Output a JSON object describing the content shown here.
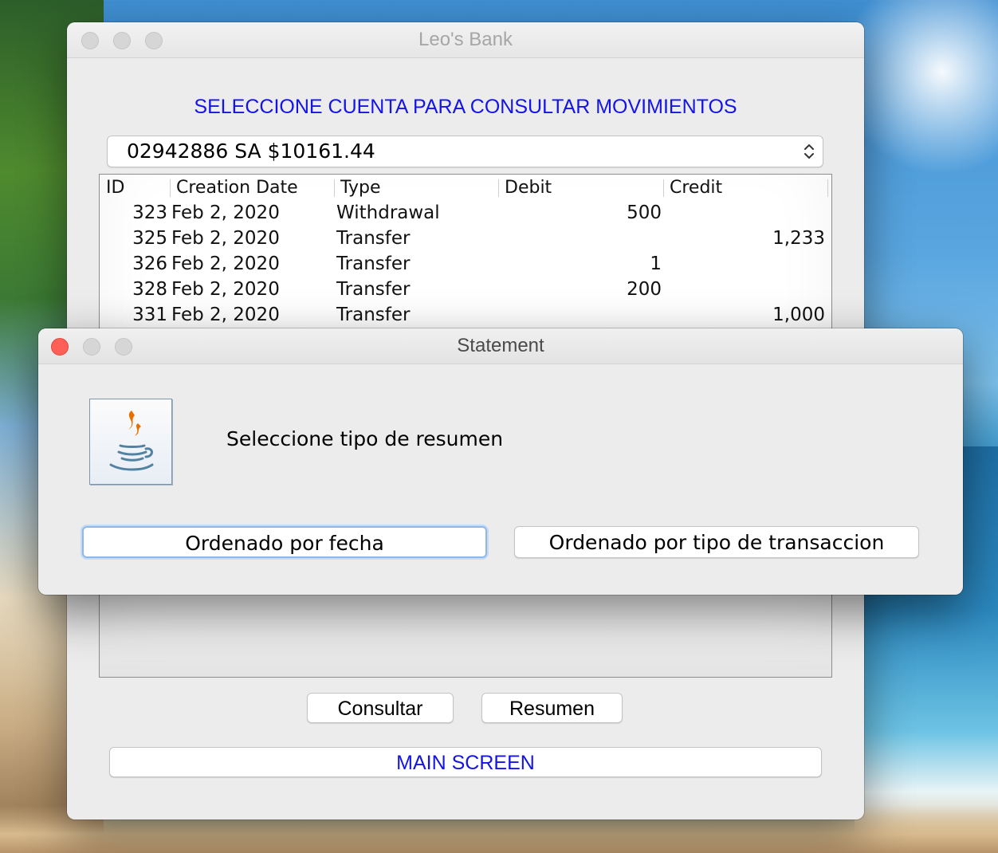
{
  "main_window": {
    "title": "Leo's Bank",
    "heading": "SELECCIONE CUENTA PARA CONSULTAR MOVIMIENTOS",
    "account_selected": "02942886 SA $10161.44",
    "table": {
      "columns": [
        "ID",
        "Creation Date",
        "Type",
        "Debit",
        "Credit"
      ],
      "rows": [
        {
          "id": "323",
          "date": "Feb 2, 2020",
          "type": "Withdrawal",
          "debit": "500",
          "credit": ""
        },
        {
          "id": "325",
          "date": "Feb 2, 2020",
          "type": "Transfer",
          "debit": "",
          "credit": "1,233"
        },
        {
          "id": "326",
          "date": "Feb 2, 2020",
          "type": "Transfer",
          "debit": "1",
          "credit": ""
        },
        {
          "id": "328",
          "date": "Feb 2, 2020",
          "type": "Transfer",
          "debit": "200",
          "credit": ""
        },
        {
          "id": "331",
          "date": "Feb 2, 2020",
          "type": "Transfer",
          "debit": "",
          "credit": "1,000"
        }
      ]
    },
    "buttons": {
      "consultar": "Consultar",
      "resumen": "Resumen",
      "main_screen": "MAIN SCREEN"
    },
    "colors": {
      "accent_text": "#1414e6"
    }
  },
  "dialog": {
    "title": "Statement",
    "message": "Seleccione tipo de resumen",
    "icon": "java-icon",
    "buttons": {
      "by_date": "Ordenado por fecha",
      "by_type": "Ordenado por tipo de transaccion"
    },
    "colors": {
      "close": "#fe5f57",
      "focus_ring": "#8fb8e8"
    }
  }
}
